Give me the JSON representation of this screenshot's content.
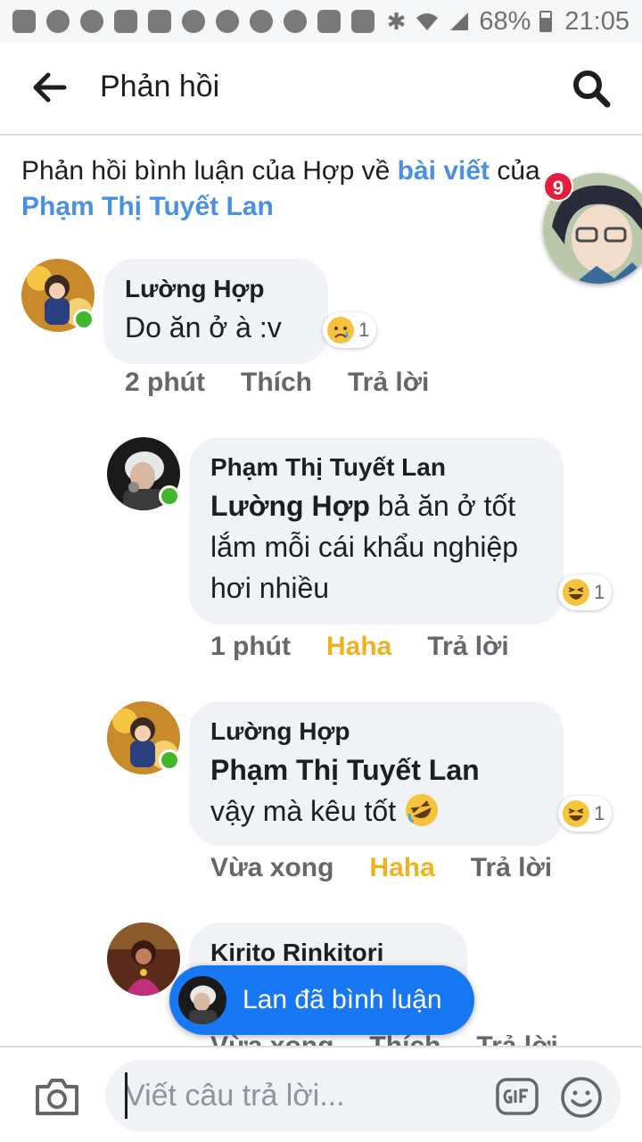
{
  "status_bar": {
    "battery": "68%",
    "time": "21:05"
  },
  "header": {
    "title": "Phản hồi"
  },
  "context": {
    "prefix": "Phản hồi bình luận của Hợp về ",
    "post_link": "bài viết",
    "middle": " của",
    "author_link": "Phạm Thị Tuyết Lan"
  },
  "chat_head": {
    "badge": "9"
  },
  "comments": [
    {
      "name": "Lường Hợp",
      "text": "Do ăn ở à :v",
      "reaction_icon": "sad-face-icon",
      "reaction_count": "1",
      "time": "2 phút",
      "like_label": "Thích",
      "reply_label": "Trả lời"
    },
    {
      "name": "Phạm Thị Tuyết Lan",
      "mention": "Lường Hợp",
      "text": " bả ăn ở tốt lắm mỗi cái khẩu nghiệp hơi nhiều",
      "reaction_icon": "laughing-face-icon",
      "reaction_count": "1",
      "time": "1 phút",
      "like_label": "Haha",
      "reply_label": "Trả lời"
    },
    {
      "name": "Lường Hợp",
      "mention": "Phạm Thị Tuyết Lan",
      "text": "vậy mà kêu tốt ",
      "emoji": "rolling-laughing-emoji",
      "reaction_icon": "laughing-face-icon",
      "reaction_count": "1",
      "time": "Vừa xong",
      "like_label": "Haha",
      "reply_label": "Trả lời"
    },
    {
      "name": "Kirito Rinkitori",
      "time": "Vừa xong",
      "like_label": "Thích",
      "reply_label": "Trả lời"
    }
  ],
  "toast": {
    "text": "Lan đã bình luận"
  },
  "composer": {
    "placeholder": "Viết câu trả lời..."
  },
  "colors": {
    "link_blue": "#4a90e2",
    "haha_yellow": "#f0b31f",
    "toast_blue": "#1877f2",
    "bubble_gray": "#f0f2f5",
    "online_green": "#42b72a",
    "badge_red": "#e41e3f"
  }
}
